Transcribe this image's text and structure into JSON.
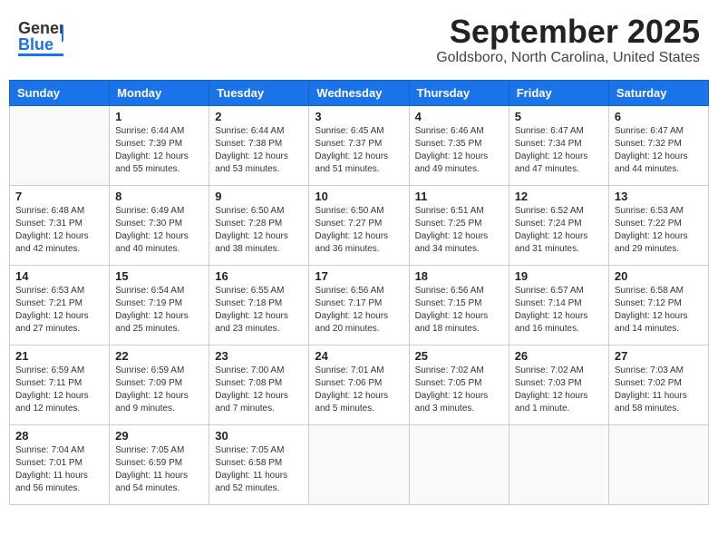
{
  "header": {
    "logo_line1": "General",
    "logo_line2": "Blue",
    "month": "September 2025",
    "location": "Goldsboro, North Carolina, United States"
  },
  "weekdays": [
    "Sunday",
    "Monday",
    "Tuesday",
    "Wednesday",
    "Thursday",
    "Friday",
    "Saturday"
  ],
  "weeks": [
    [
      {
        "day": "",
        "sunrise": "",
        "sunset": "",
        "daylight": ""
      },
      {
        "day": "1",
        "sunrise": "Sunrise: 6:44 AM",
        "sunset": "Sunset: 7:39 PM",
        "daylight": "Daylight: 12 hours and 55 minutes."
      },
      {
        "day": "2",
        "sunrise": "Sunrise: 6:44 AM",
        "sunset": "Sunset: 7:38 PM",
        "daylight": "Daylight: 12 hours and 53 minutes."
      },
      {
        "day": "3",
        "sunrise": "Sunrise: 6:45 AM",
        "sunset": "Sunset: 7:37 PM",
        "daylight": "Daylight: 12 hours and 51 minutes."
      },
      {
        "day": "4",
        "sunrise": "Sunrise: 6:46 AM",
        "sunset": "Sunset: 7:35 PM",
        "daylight": "Daylight: 12 hours and 49 minutes."
      },
      {
        "day": "5",
        "sunrise": "Sunrise: 6:47 AM",
        "sunset": "Sunset: 7:34 PM",
        "daylight": "Daylight: 12 hours and 47 minutes."
      },
      {
        "day": "6",
        "sunrise": "Sunrise: 6:47 AM",
        "sunset": "Sunset: 7:32 PM",
        "daylight": "Daylight: 12 hours and 44 minutes."
      }
    ],
    [
      {
        "day": "7",
        "sunrise": "Sunrise: 6:48 AM",
        "sunset": "Sunset: 7:31 PM",
        "daylight": "Daylight: 12 hours and 42 minutes."
      },
      {
        "day": "8",
        "sunrise": "Sunrise: 6:49 AM",
        "sunset": "Sunset: 7:30 PM",
        "daylight": "Daylight: 12 hours and 40 minutes."
      },
      {
        "day": "9",
        "sunrise": "Sunrise: 6:50 AM",
        "sunset": "Sunset: 7:28 PM",
        "daylight": "Daylight: 12 hours and 38 minutes."
      },
      {
        "day": "10",
        "sunrise": "Sunrise: 6:50 AM",
        "sunset": "Sunset: 7:27 PM",
        "daylight": "Daylight: 12 hours and 36 minutes."
      },
      {
        "day": "11",
        "sunrise": "Sunrise: 6:51 AM",
        "sunset": "Sunset: 7:25 PM",
        "daylight": "Daylight: 12 hours and 34 minutes."
      },
      {
        "day": "12",
        "sunrise": "Sunrise: 6:52 AM",
        "sunset": "Sunset: 7:24 PM",
        "daylight": "Daylight: 12 hours and 31 minutes."
      },
      {
        "day": "13",
        "sunrise": "Sunrise: 6:53 AM",
        "sunset": "Sunset: 7:22 PM",
        "daylight": "Daylight: 12 hours and 29 minutes."
      }
    ],
    [
      {
        "day": "14",
        "sunrise": "Sunrise: 6:53 AM",
        "sunset": "Sunset: 7:21 PM",
        "daylight": "Daylight: 12 hours and 27 minutes."
      },
      {
        "day": "15",
        "sunrise": "Sunrise: 6:54 AM",
        "sunset": "Sunset: 7:19 PM",
        "daylight": "Daylight: 12 hours and 25 minutes."
      },
      {
        "day": "16",
        "sunrise": "Sunrise: 6:55 AM",
        "sunset": "Sunset: 7:18 PM",
        "daylight": "Daylight: 12 hours and 23 minutes."
      },
      {
        "day": "17",
        "sunrise": "Sunrise: 6:56 AM",
        "sunset": "Sunset: 7:17 PM",
        "daylight": "Daylight: 12 hours and 20 minutes."
      },
      {
        "day": "18",
        "sunrise": "Sunrise: 6:56 AM",
        "sunset": "Sunset: 7:15 PM",
        "daylight": "Daylight: 12 hours and 18 minutes."
      },
      {
        "day": "19",
        "sunrise": "Sunrise: 6:57 AM",
        "sunset": "Sunset: 7:14 PM",
        "daylight": "Daylight: 12 hours and 16 minutes."
      },
      {
        "day": "20",
        "sunrise": "Sunrise: 6:58 AM",
        "sunset": "Sunset: 7:12 PM",
        "daylight": "Daylight: 12 hours and 14 minutes."
      }
    ],
    [
      {
        "day": "21",
        "sunrise": "Sunrise: 6:59 AM",
        "sunset": "Sunset: 7:11 PM",
        "daylight": "Daylight: 12 hours and 12 minutes."
      },
      {
        "day": "22",
        "sunrise": "Sunrise: 6:59 AM",
        "sunset": "Sunset: 7:09 PM",
        "daylight": "Daylight: 12 hours and 9 minutes."
      },
      {
        "day": "23",
        "sunrise": "Sunrise: 7:00 AM",
        "sunset": "Sunset: 7:08 PM",
        "daylight": "Daylight: 12 hours and 7 minutes."
      },
      {
        "day": "24",
        "sunrise": "Sunrise: 7:01 AM",
        "sunset": "Sunset: 7:06 PM",
        "daylight": "Daylight: 12 hours and 5 minutes."
      },
      {
        "day": "25",
        "sunrise": "Sunrise: 7:02 AM",
        "sunset": "Sunset: 7:05 PM",
        "daylight": "Daylight: 12 hours and 3 minutes."
      },
      {
        "day": "26",
        "sunrise": "Sunrise: 7:02 AM",
        "sunset": "Sunset: 7:03 PM",
        "daylight": "Daylight: 12 hours and 1 minute."
      },
      {
        "day": "27",
        "sunrise": "Sunrise: 7:03 AM",
        "sunset": "Sunset: 7:02 PM",
        "daylight": "Daylight: 11 hours and 58 minutes."
      }
    ],
    [
      {
        "day": "28",
        "sunrise": "Sunrise: 7:04 AM",
        "sunset": "Sunset: 7:01 PM",
        "daylight": "Daylight: 11 hours and 56 minutes."
      },
      {
        "day": "29",
        "sunrise": "Sunrise: 7:05 AM",
        "sunset": "Sunset: 6:59 PM",
        "daylight": "Daylight: 11 hours and 54 minutes."
      },
      {
        "day": "30",
        "sunrise": "Sunrise: 7:05 AM",
        "sunset": "Sunset: 6:58 PM",
        "daylight": "Daylight: 11 hours and 52 minutes."
      },
      {
        "day": "",
        "sunrise": "",
        "sunset": "",
        "daylight": ""
      },
      {
        "day": "",
        "sunrise": "",
        "sunset": "",
        "daylight": ""
      },
      {
        "day": "",
        "sunrise": "",
        "sunset": "",
        "daylight": ""
      },
      {
        "day": "",
        "sunrise": "",
        "sunset": "",
        "daylight": ""
      }
    ]
  ]
}
